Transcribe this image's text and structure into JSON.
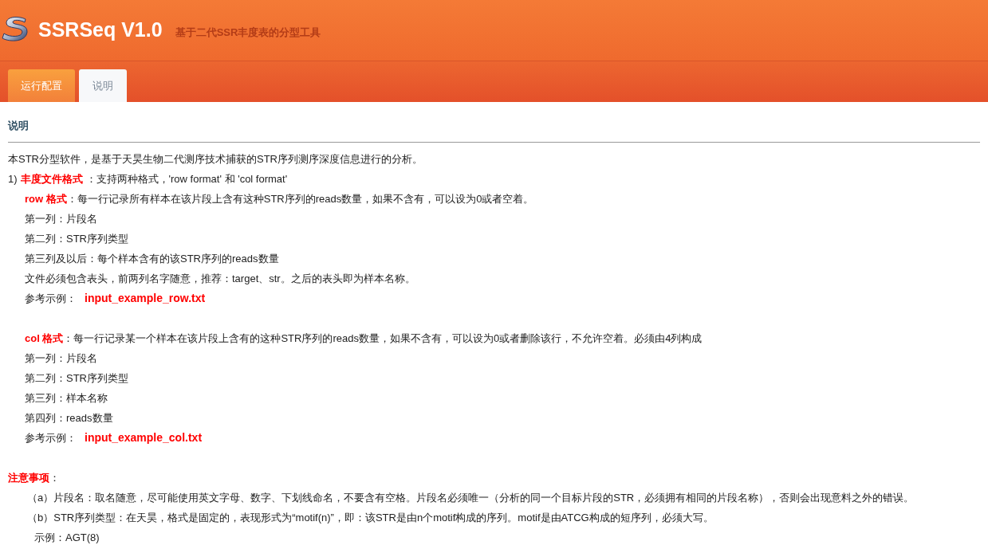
{
  "header": {
    "title": "SSRSeq V1.0",
    "subtitle": "基于二代SSR丰度表的分型工具"
  },
  "tabs": [
    {
      "label": "运行配置",
      "selected": false
    },
    {
      "label": "说明",
      "selected": true
    }
  ],
  "section_title": "说明",
  "content": [
    {
      "kind": "plain",
      "text": "本STR分型软件，是基于天昊生物二代测序技术捕获的STR序列测序深度信息进行的分析。"
    },
    {
      "kind": "heading",
      "prefix": "1)",
      "label": "丰度文件格式",
      "text": "：支持两种格式，'row format' 和 'col format'"
    },
    {
      "kind": "format",
      "label": "row 格式",
      "text": "：每一行记录所有样本在该片段上含有这种STR序列的reads数量，如果不含有，可以设为0或者空着。",
      "children": [
        {
          "kind": "plain",
          "text": "第一列：片段名"
        },
        {
          "kind": "plain",
          "text": "第二列：STR序列类型"
        },
        {
          "kind": "plain",
          "text": "第三列及以后：每个样本含有的该STR序列的reads数量"
        },
        {
          "kind": "plain",
          "text": "文件必须包含表头，前两列名字随意，推荐：target、str。之后的表头即为样本名称。"
        },
        {
          "kind": "example",
          "text": "参考示例：",
          "file": "input_example_row.txt"
        }
      ]
    },
    {
      "kind": "format",
      "label": "col 格式",
      "text": "：每一行记录某一个样本在该片段上含有的这种STR序列的reads数量，如果不含有，可以设为0或者删除该行，不允许空着。必须由4列构成",
      "children": [
        {
          "kind": "plain",
          "text": "第一列：片段名"
        },
        {
          "kind": "plain",
          "text": "第二列：STR序列类型"
        },
        {
          "kind": "plain",
          "text": "第三列：样本名称"
        },
        {
          "kind": "plain",
          "text": "第四列：reads数量"
        },
        {
          "kind": "example",
          "text": "参考示例：",
          "file": "input_example_col.txt"
        }
      ]
    },
    {
      "kind": "note",
      "label": "注意事项",
      "text": "：",
      "children": [
        {
          "kind": "plain",
          "text": "（a）片段名：取名随意，尽可能使用英文字母、数字、下划线命名，不要含有空格。片段名必须唯一（分析的同一个目标片段的STR，必须拥有相同的片段名称），否则会出现意料之外的错误。"
        },
        {
          "kind": "plain",
          "text": "（b）STR序列类型：在天昊，格式是固定的，表现形式为“motif(n)”，即：该STR是由n个motif构成的序列。motif是由ATCG构成的短序列，必须大写。",
          "children": [
            {
              "kind": "plain",
              "text": "示例：AGT(8)"
            }
          ]
        }
      ]
    }
  ]
}
